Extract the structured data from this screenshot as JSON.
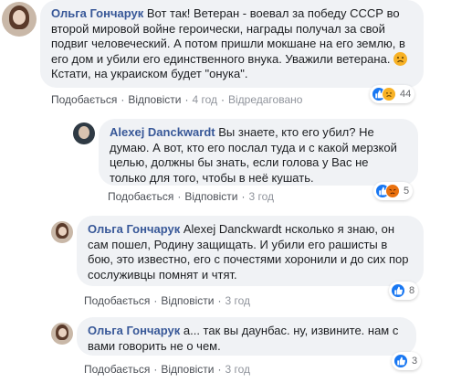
{
  "labels": {
    "like": "Подобається",
    "reply": "Відповісти",
    "edited": "Відредаговано"
  },
  "comments": [
    {
      "author": "Ольга Гончарук",
      "text": "Вот так! Ветеран - воевал за победу СССР во второй мировой войне героически, награды получал за свой подвиг человеческий. А потом пришли мокшане на его землю, в его дом и убили его единственного внука. Уважили ветерана.",
      "text_after": "Кстати, на украиском будет \"онука\".",
      "time": "4 год",
      "reaction_count": "44",
      "reactions": [
        "like-icon",
        "sad-icon"
      ]
    },
    {
      "author": "Alexej Danckwardt",
      "text": "Вы знаете, кто его убил? Не думаю. А вот, кто его послал туда и с какой мерзкой целью, должны бы знать, если голова у Вас не только для того, чтобы в неё кушать.",
      "time": "3 год",
      "reaction_count": "5",
      "reactions": [
        "like-icon",
        "angry-icon"
      ]
    },
    {
      "author": "Ольга Гончарук",
      "text": "Alexej Danckwardt нсколько я знаю, он сам пошел, Родину защищать. И убили его рашисты в бою, это известно, его с почестями хоронили и до сих пор сослуживцы помнят и чтят.",
      "time": "3 год",
      "reaction_count": "8",
      "reactions": [
        "like-icon"
      ]
    },
    {
      "author": "Ольга Гончарук",
      "text": "а... так вы даунбас. ну, извините. нам с вами говорить не о чем.",
      "time": "3 год",
      "reaction_count": "3",
      "reactions": [
        "like-icon"
      ]
    }
  ],
  "colors": {
    "author": "#385898",
    "bubble": "#f0f2f5",
    "like": "#1877f2",
    "sad": "#f7b125",
    "angry": "#e9710f"
  }
}
